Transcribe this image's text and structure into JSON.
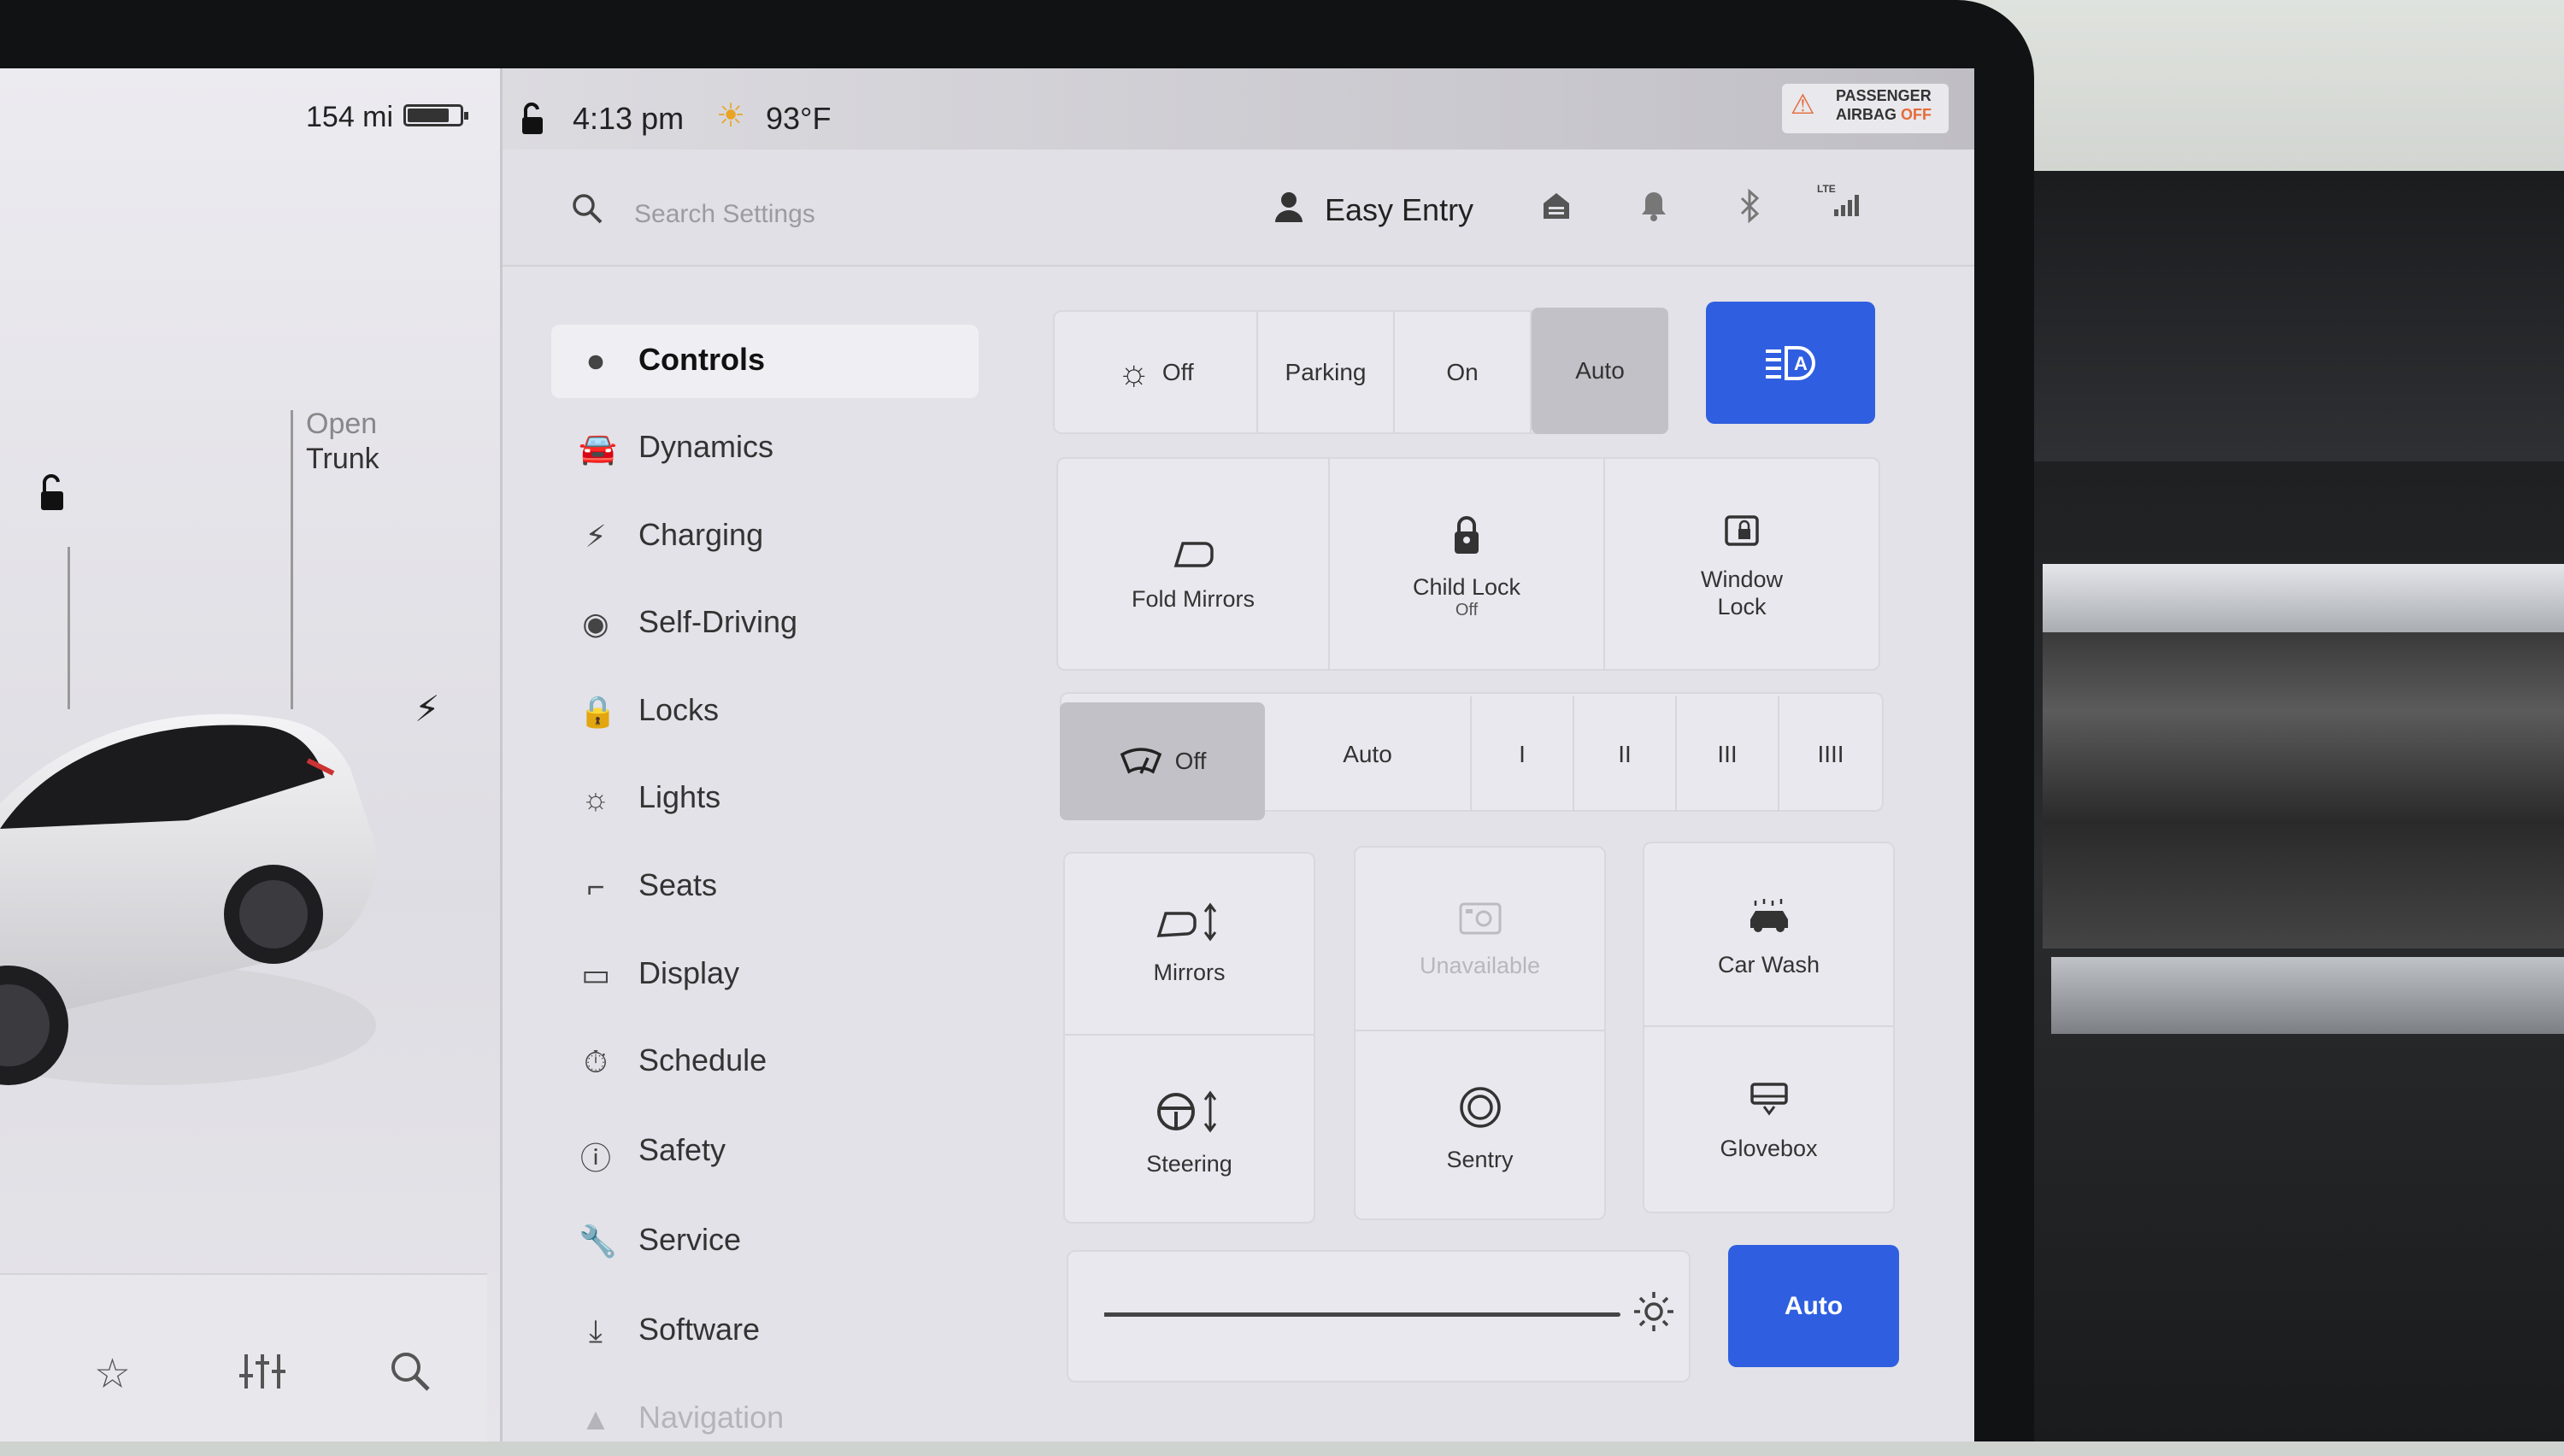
{
  "status": {
    "range": "154 mi",
    "battery_level": 0.8,
    "time": "4:13 pm",
    "temperature": "93°F",
    "airbag_line1": "PASSENGER",
    "airbag_line2": "AIRBAG",
    "airbag_state": "OFF"
  },
  "car_panel": {
    "trunk_open": "Open",
    "trunk_label": "Trunk"
  },
  "header": {
    "search_placeholder": "Search Settings",
    "profile_name": "Easy Entry",
    "lte": "LTE"
  },
  "sidebar": {
    "items": [
      {
        "label": "Controls",
        "icon": "toggle-icon"
      },
      {
        "label": "Dynamics",
        "icon": "car-icon"
      },
      {
        "label": "Charging",
        "icon": "bolt-icon"
      },
      {
        "label": "Self-Driving",
        "icon": "steering-wheel-icon"
      },
      {
        "label": "Locks",
        "icon": "lock-icon"
      },
      {
        "label": "Lights",
        "icon": "light-icon"
      },
      {
        "label": "Seats",
        "icon": "seat-icon"
      },
      {
        "label": "Display",
        "icon": "display-icon"
      },
      {
        "label": "Schedule",
        "icon": "schedule-icon"
      },
      {
        "label": "Safety",
        "icon": "safety-icon"
      },
      {
        "label": "Service",
        "icon": "wrench-icon"
      },
      {
        "label": "Software",
        "icon": "download-icon"
      },
      {
        "label": "Navigation",
        "icon": "navigation-icon"
      }
    ]
  },
  "lights": {
    "off": "Off",
    "parking": "Parking",
    "on": "On",
    "auto": "Auto",
    "selected": "Auto"
  },
  "quick": {
    "fold_mirrors": "Fold Mirrors",
    "child_lock": "Child Lock",
    "child_lock_state": "Off",
    "window_lock_1": "Window",
    "window_lock_2": "Lock"
  },
  "wipers": {
    "off": "Off",
    "auto": "Auto",
    "s1": "I",
    "s2": "II",
    "s3": "III",
    "s4": "IIII",
    "selected": "Off"
  },
  "tiles": {
    "mirrors": "Mirrors",
    "unavailable": "Unavailable",
    "car_wash": "Car Wash",
    "steering": "Steering",
    "sentry": "Sentry",
    "glovebox": "Glovebox"
  },
  "brightness": {
    "level": 0.95,
    "auto": "Auto"
  },
  "colors": {
    "accent": "#2f5fe0",
    "selected_segment": "#c2c1c7"
  }
}
